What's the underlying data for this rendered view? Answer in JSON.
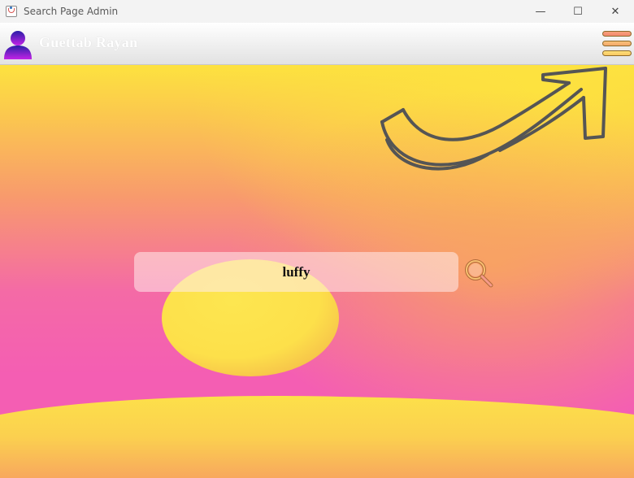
{
  "window": {
    "title": "Search Page Admin",
    "controls": {
      "minimize": "—",
      "maximize": "☐",
      "close": "✕"
    }
  },
  "header": {
    "user_name": "Guettab Rayan",
    "avatar_icon": "user-avatar-icon",
    "menu_icon": "hamburger-menu-icon"
  },
  "search": {
    "value": "luffy",
    "icon": "magnifier-icon"
  },
  "colors": {
    "background_yellow": "#fde23f",
    "background_pink": "#f45eb3",
    "background_orange": "#f8a55e",
    "sun": "#fde04a",
    "arrow_stroke": "#555555",
    "avatar_gradient_top": "#2a1fa8",
    "avatar_gradient_bottom": "#c323e6"
  }
}
